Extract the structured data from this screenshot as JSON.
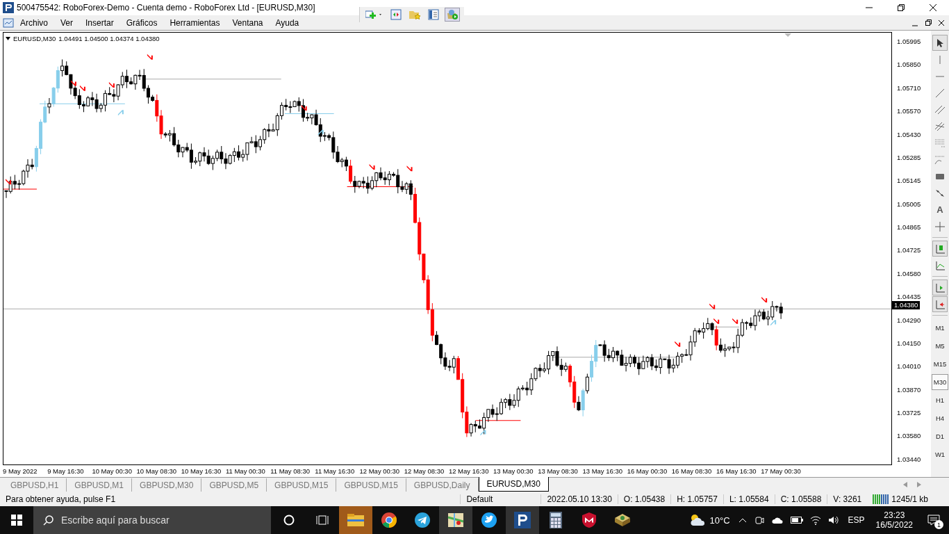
{
  "window": {
    "title": "500475542: RoboForex-Demo - Cuenta demo - RoboForex Ltd - [EURUSD,M30]"
  },
  "menu": [
    "Archivo",
    "Ver",
    "Insertar",
    "Gráficos",
    "Herramientas",
    "Ventana",
    "Ayuda"
  ],
  "chart": {
    "symbol": "EURUSD,M30",
    "quote": "1.04491 1.04500 1.04374 1.04380",
    "current_price": "1.04380",
    "price_ticks": [
      "1.05995",
      "1.05850",
      "1.05710",
      "1.05570",
      "1.05430",
      "1.05285",
      "1.05145",
      "1.05005",
      "1.04865",
      "1.04725",
      "1.04580",
      "1.04435",
      "1.04290",
      "1.04150",
      "1.04010",
      "1.03870",
      "1.03725",
      "1.03580",
      "1.03440"
    ],
    "time_ticks": [
      "9 May 2022",
      "9 May 16:30",
      "10 May 00:30",
      "10 May 08:30",
      "10 May 16:30",
      "11 May 00:30",
      "11 May 08:30",
      "11 May 16:30",
      "12 May 00:30",
      "12 May 08:30",
      "12 May 16:30",
      "13 May 00:30",
      "13 May 08:30",
      "13 May 16:30",
      "16 May 00:30",
      "16 May 08:30",
      "16 May 16:30",
      "17 May 00:30"
    ]
  },
  "tools": [
    {
      "kind": "cursor",
      "selected": true
    },
    {
      "kind": "vline",
      "selected": false
    },
    {
      "kind": "hline",
      "selected": false
    },
    {
      "kind": "trend",
      "selected": false
    },
    {
      "kind": "channel",
      "selected": false
    },
    {
      "kind": "fibo",
      "selected": false
    },
    {
      "kind": "levels",
      "selected": false
    },
    {
      "kind": "fan",
      "selected": false
    },
    {
      "kind": "rect",
      "selected": false
    },
    {
      "kind": "arrows",
      "selected": false
    },
    {
      "kind": "text",
      "label": "A",
      "selected": false
    },
    {
      "kind": "cross",
      "selected": false
    }
  ],
  "chart_tools": [
    {
      "kind": "candles",
      "selected": true
    },
    {
      "kind": "indicator",
      "selected": false
    },
    {
      "kind": "autoscroll",
      "selected": true
    },
    {
      "kind": "shift",
      "selected": true
    }
  ],
  "timeframes": [
    {
      "label": "M1",
      "selected": false
    },
    {
      "label": "M5",
      "selected": false
    },
    {
      "label": "M15",
      "selected": false
    },
    {
      "label": "M30",
      "selected": true
    },
    {
      "label": "H1",
      "selected": false
    },
    {
      "label": "H4",
      "selected": false
    },
    {
      "label": "D1",
      "selected": false
    },
    {
      "label": "W1",
      "selected": false
    }
  ],
  "tabs": [
    {
      "label": "GBPUSD,H1",
      "selected": false
    },
    {
      "label": "GBPUSD,M1",
      "selected": false
    },
    {
      "label": "GBPUSD,M30",
      "selected": false
    },
    {
      "label": "GBPUSD,M5",
      "selected": false
    },
    {
      "label": "GBPUSD,M15",
      "selected": false
    },
    {
      "label": "GBPUSD,M15",
      "selected": false
    },
    {
      "label": "GBPUSD,Daily",
      "selected": false
    },
    {
      "label": "EURUSD,M30",
      "selected": true
    }
  ],
  "status_bar": {
    "help": "Para obtener ayuda, pulse F1",
    "profile": "Default",
    "fields": [
      "2022.05.10 13:30",
      "O: 1.05438",
      "H: 1.05757",
      "L: 1.05584",
      "C: 1.05588",
      "V: 3261"
    ],
    "traffic": "1245/1 kb"
  },
  "taskbar": {
    "search": {
      "placeholder": "Escribe aquí para buscar"
    },
    "temperature": "10°C",
    "language": "ESP",
    "time": "23:23",
    "date": "16/5/2022",
    "notifications": "1"
  }
}
